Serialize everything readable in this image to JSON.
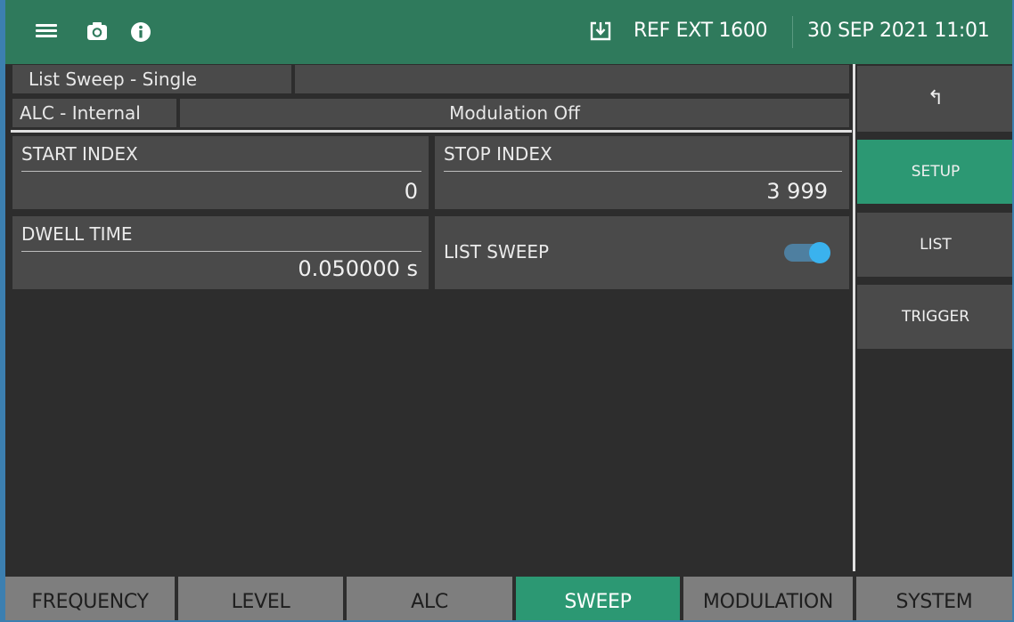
{
  "topbar": {
    "ref_status": "REF EXT 1600",
    "datetime": "30 SEP 2021 11:01",
    "icons": [
      "menu-icon",
      "camera-icon",
      "info-icon",
      "download-box-icon"
    ],
    "bar_color": "#2f7a5c"
  },
  "status": {
    "sweep_mode": "List Sweep - Single",
    "alc": "ALC - Internal",
    "modulation": "Modulation Off"
  },
  "params": {
    "start_index": {
      "label": "START INDEX",
      "value": "0"
    },
    "stop_index": {
      "label": "STOP INDEX",
      "value": "3 999"
    },
    "dwell_time": {
      "label": "DWELL TIME",
      "value": "0.050000 s"
    },
    "list_sweep": {
      "label": "LIST SWEEP",
      "enabled": true
    }
  },
  "side_menu": {
    "back_label": "↰",
    "items": [
      {
        "label": "SETUP",
        "active": true
      },
      {
        "label": "LIST",
        "active": false
      },
      {
        "label": "TRIGGER",
        "active": false
      }
    ]
  },
  "tabs": [
    {
      "label": "FREQUENCY",
      "active": false
    },
    {
      "label": "LEVEL",
      "active": false
    },
    {
      "label": "ALC",
      "active": false
    },
    {
      "label": "SWEEP",
      "active": true
    },
    {
      "label": "MODULATION",
      "active": false
    },
    {
      "label": "SYSTEM",
      "active": false
    }
  ],
  "colors": {
    "accent": "#2c9873",
    "panel": "#4a4a4a",
    "background": "#2d2d2d",
    "toggle_knob": "#3ab2ee"
  }
}
